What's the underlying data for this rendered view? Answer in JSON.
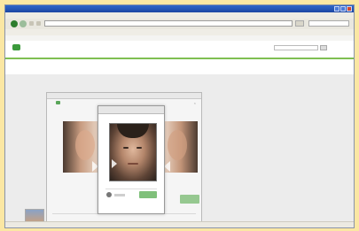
{
  "window": {
    "title": "",
    "colors": {
      "titlebar": "#1c46a3",
      "brand_green": "#3c9a3c",
      "link_blue": "#4a6fb0",
      "accept_green": "#7fc07a"
    }
  },
  "menubar": {
    "items": []
  },
  "navbar": {
    "url": "",
    "search_placeholder": ""
  },
  "bookmarks": {
    "items": []
  },
  "google_bar": {
    "left_links": [],
    "right_links": []
  },
  "site": {
    "name": "",
    "subtitle": "",
    "tabs": [],
    "links": [],
    "help_link": "",
    "subrow_text": "",
    "subrow_green": ""
  },
  "outer_dialog": {
    "title": "",
    "heading": "",
    "close_icon": "close-icon"
  },
  "inner_dialog": {
    "title": ""
  },
  "icons": [
    "back-icon",
    "forward-icon",
    "close-icon",
    "camera-icon",
    "arrow-left-icon",
    "arrow-right-icon"
  ]
}
